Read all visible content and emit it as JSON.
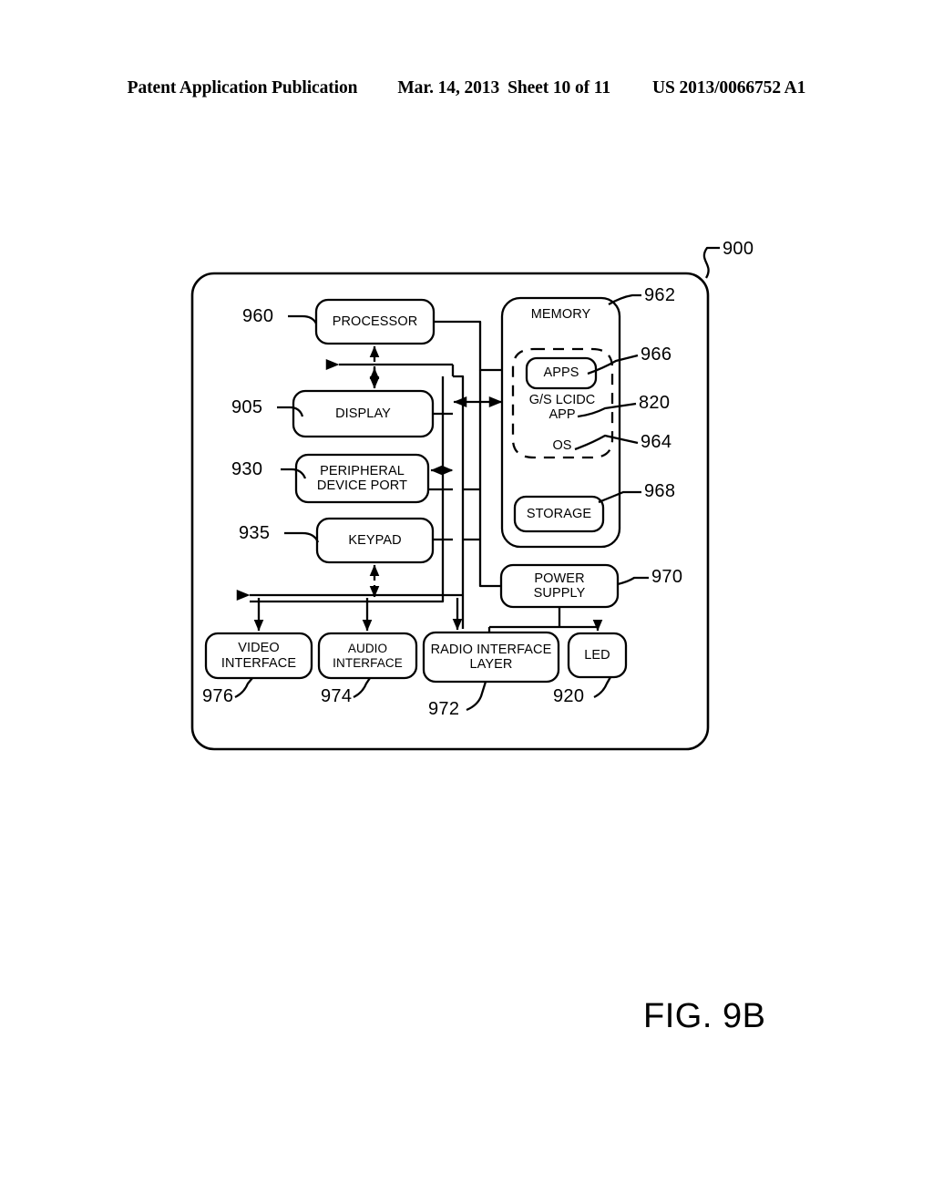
{
  "header": {
    "publication": "Patent Application Publication",
    "date": "Mar. 14, 2013",
    "sheet": "Sheet 10 of 11",
    "patent_number": "US 2013/0066752 A1"
  },
  "figure": {
    "caption": "FIG. 9B",
    "system_ref": "900"
  },
  "blocks": {
    "processor": {
      "label": "PROCESSOR",
      "ref": "960"
    },
    "display": {
      "label": "DISPLAY",
      "ref": "905"
    },
    "peripheral_port": {
      "label": "PERIPHERAL DEVICE PORT",
      "line1": "PERIPHERAL",
      "line2": "DEVICE PORT",
      "ref": "930"
    },
    "keypad": {
      "label": "KEYPAD",
      "ref": "935"
    },
    "memory": {
      "label": "MEMORY",
      "ref": "962"
    },
    "apps": {
      "label": "APPS",
      "ref": "966"
    },
    "gs_lcidc_app": {
      "line1": "G/S LCIDC",
      "line2": "APP",
      "ref": "820"
    },
    "os": {
      "label": "OS",
      "ref": "964"
    },
    "storage": {
      "label": "STORAGE",
      "ref": "968"
    },
    "power_supply": {
      "label": "POWER SUPPLY",
      "line1": "POWER",
      "line2": "SUPPLY",
      "ref": "970"
    },
    "video_interface": {
      "label": "VIDEO INTERFACE",
      "line1": "VIDEO",
      "line2": "INTERFACE",
      "ref": "976"
    },
    "audio_interface": {
      "label": "AUDIO INTERFACE",
      "line1": "AUDIO",
      "line2": "INTERFACE",
      "ref": "974"
    },
    "radio_interface": {
      "label": "RADIO INTERFACE LAYER",
      "line1": "RADIO INTERFACE",
      "line2": "LAYER",
      "ref": "972"
    },
    "led": {
      "label": "LED",
      "ref": "920"
    }
  },
  "style": {
    "stroke": "#000000",
    "background": "#ffffff"
  }
}
